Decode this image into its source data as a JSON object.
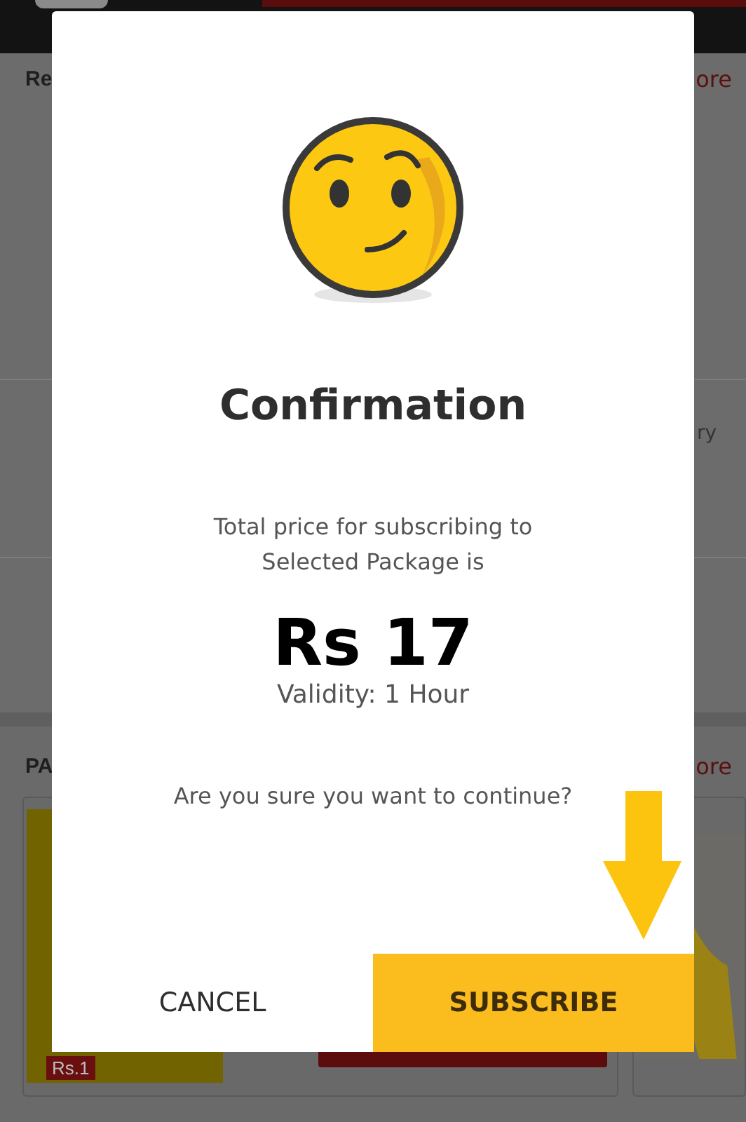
{
  "background": {
    "section_1_title": "Re",
    "section_1_link": "ore",
    "row_text": "ry",
    "section_2_title": "PA",
    "section_2_link": "ore",
    "card_price": "Rs.1"
  },
  "dialog": {
    "title": "Confirmation",
    "message": "Total price for subscribing to Selected Package is",
    "price": "Rs 17",
    "validity": "Validity: 1 Hour",
    "question": "Are you sure you want to continue?",
    "buttons": [
      {
        "label": "CANCEL",
        "kind": "plain"
      },
      {
        "label": "SUBSCRIBE",
        "kind": "primary"
      }
    ]
  }
}
